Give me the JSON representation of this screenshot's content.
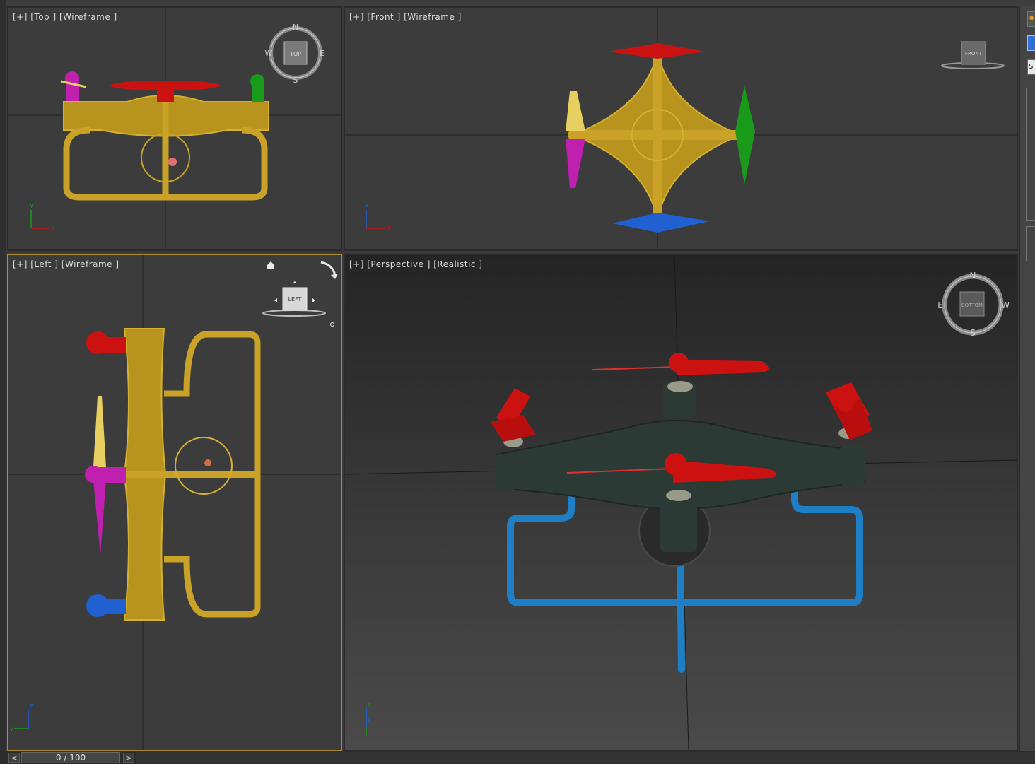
{
  "viewports": {
    "top": {
      "label": "[+] [Top ] [Wireframe ]",
      "cube_label": "TOP",
      "compass": [
        "N",
        "E",
        "S",
        "W"
      ]
    },
    "front": {
      "label": "[+] [Front ] [Wireframe ]",
      "cube_label": "FRONT"
    },
    "left": {
      "label": "[+] [Left ] [Wireframe ]",
      "cube_label": "LEFT"
    },
    "perspective": {
      "label": "[+] [Perspective ] [Realistic ]",
      "cube_label": "BOTTOM",
      "compass": [
        "N",
        "W",
        "S",
        "E"
      ]
    }
  },
  "axes": {
    "x": "x",
    "y": "y",
    "z": "z"
  },
  "command_panel": {
    "field_char": "S"
  },
  "timeline": {
    "prev": "<",
    "next": ">",
    "frame": "0 / 100"
  },
  "colors": {
    "wire": "#c9a227",
    "red": "#cc1111",
    "green": "#1a9a1a",
    "blue": "#2060d0",
    "magenta": "#c020b0",
    "yellow": "#e8d060",
    "accent": "#b08a2a"
  }
}
